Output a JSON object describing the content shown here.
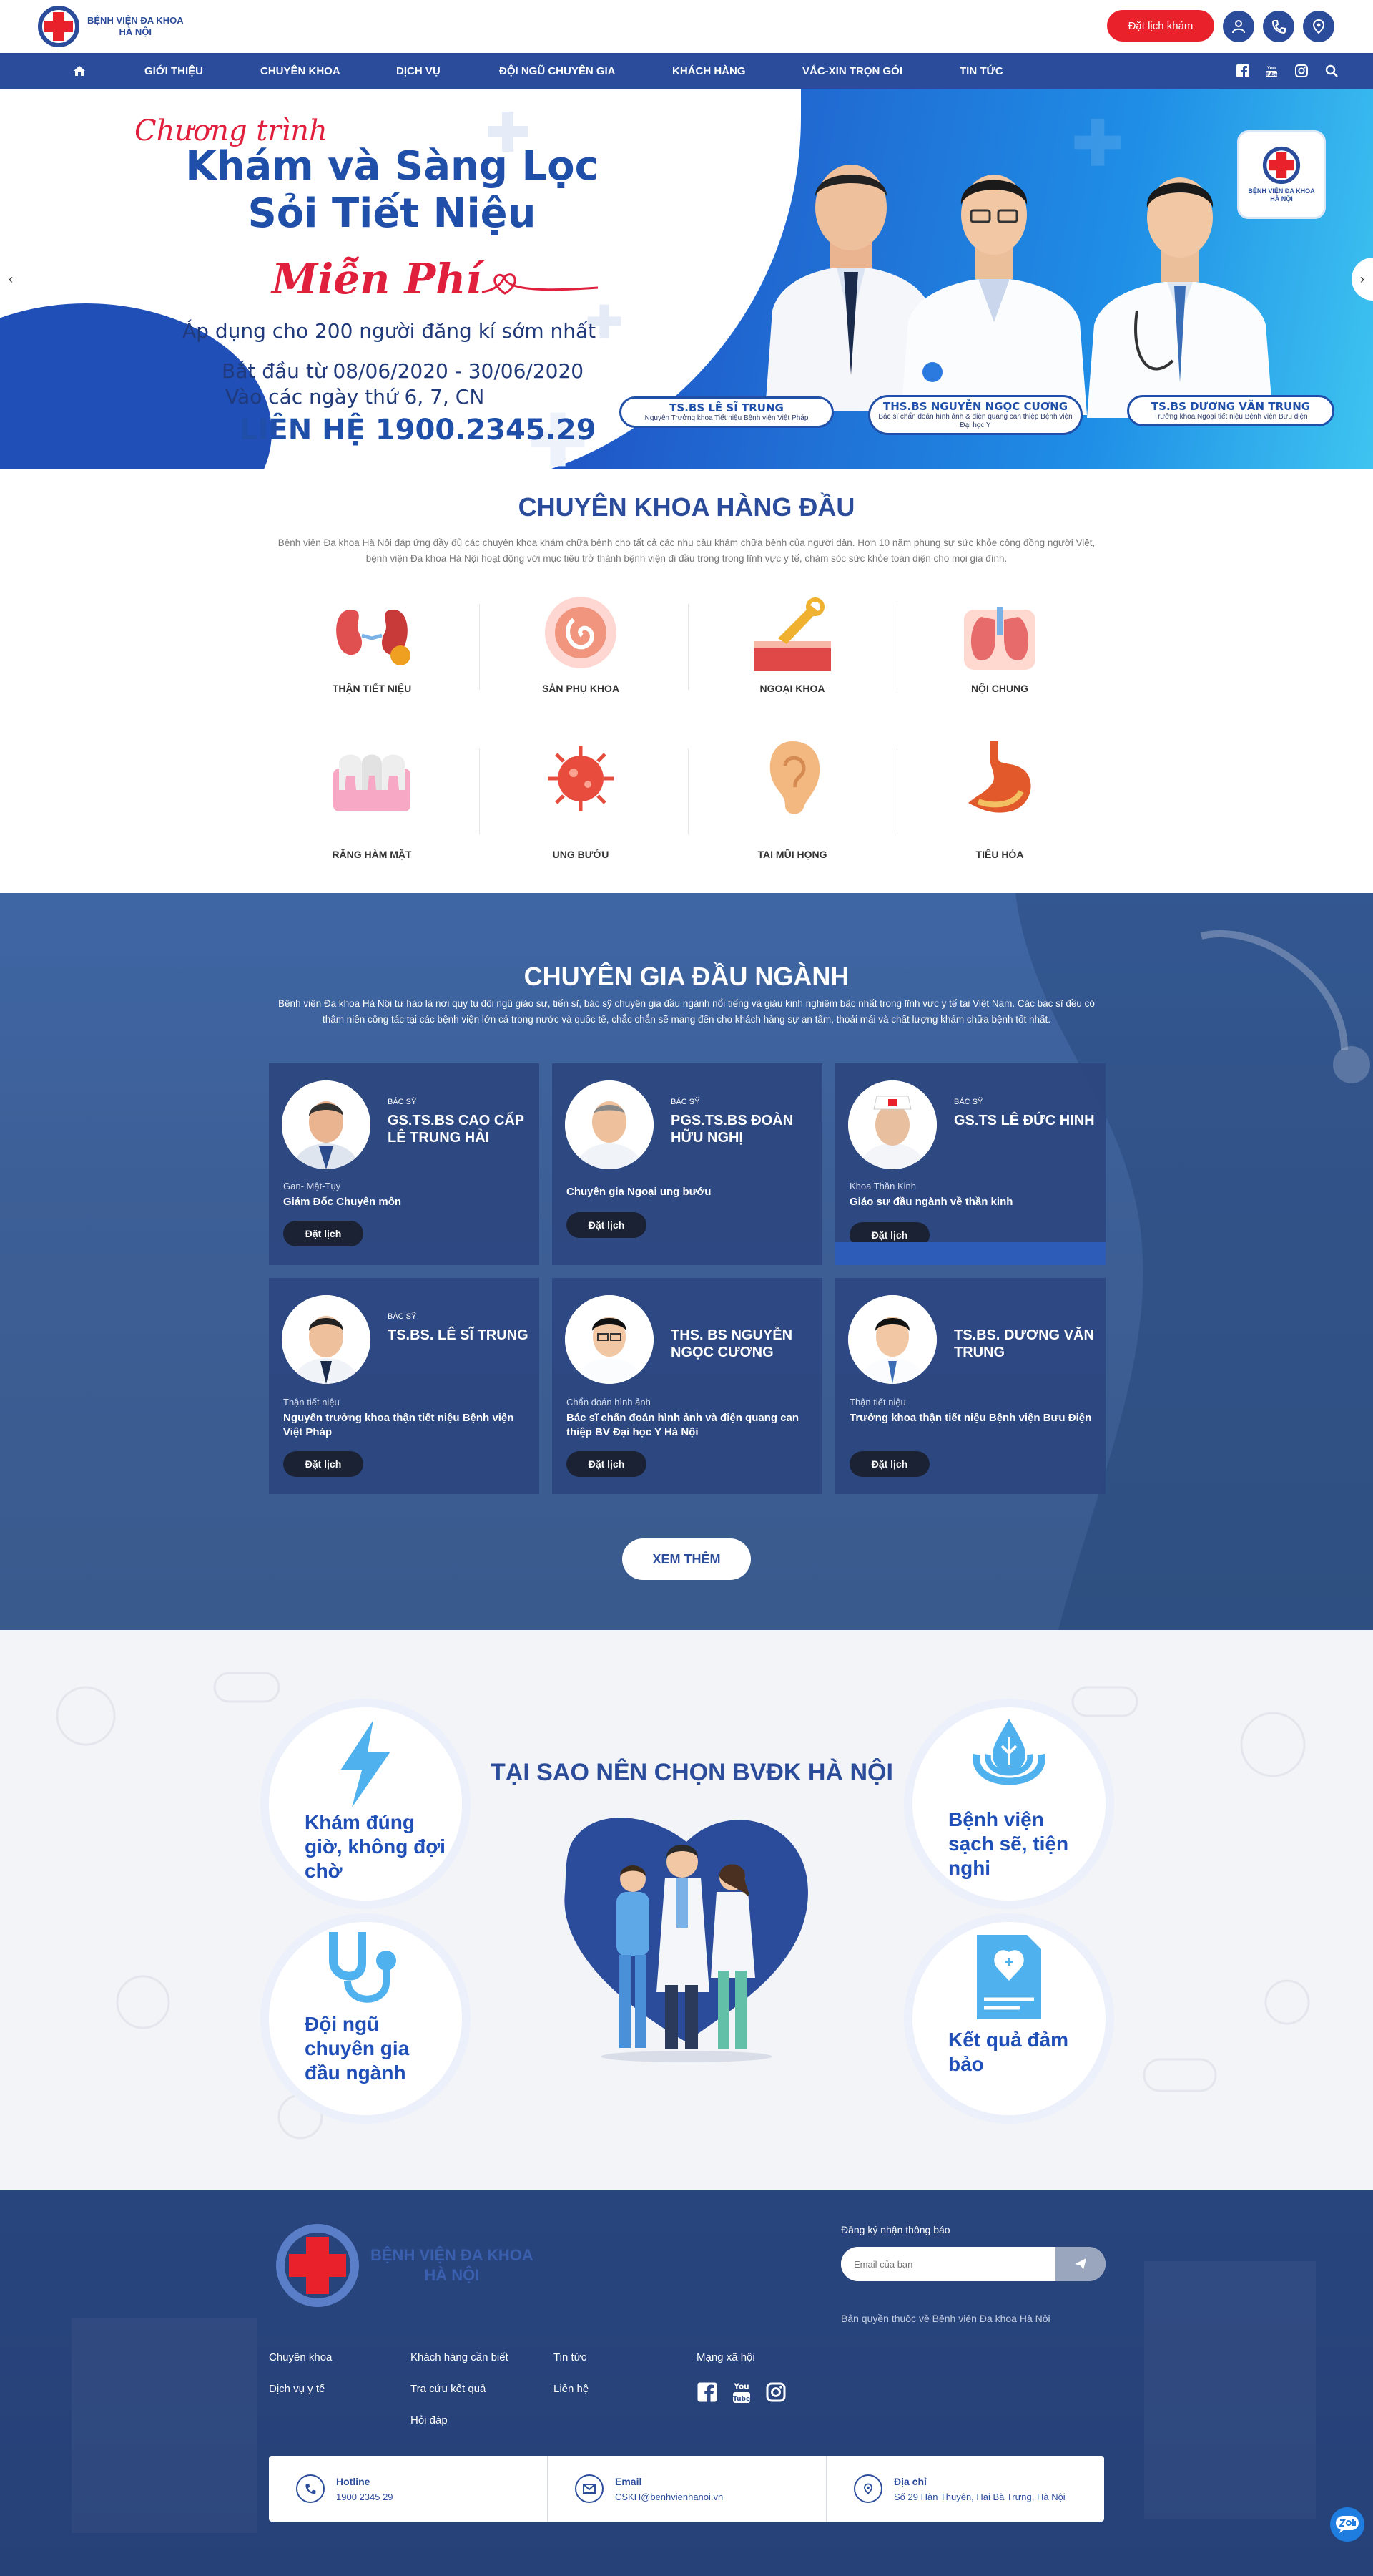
{
  "header": {
    "logo_line1": "BỆNH VIỆN ĐA KHOA",
    "logo_line2": "HÀ NỘI",
    "book_label": "Đặt lịch khám"
  },
  "nav": {
    "items": [
      "GIỚI THIỆU",
      "CHUYÊN KHOA",
      "DỊCH VỤ",
      "ĐỘI NGŨ CHUYÊN GIA",
      "KHÁCH HÀNG",
      "VẮC-XIN TRỌN GÓI",
      "TIN TỨC"
    ]
  },
  "banner": {
    "script": "Chương trình",
    "title_line1": "Khám và Sàng Lọc",
    "title_line2": "Sỏi Tiết Niệu",
    "free": "Miễn Phí",
    "apply": "Áp dụng cho 200 người đăng kí sớm nhất",
    "date": "Bắt đầu từ 08/06/2020 - 30/06/2020",
    "days": "Vào các ngày thứ 6, 7, CN",
    "phone": "LIÊN HỆ 1900.2345.29",
    "doctors": [
      {
        "name": "TS.BS LÊ SĨ TRUNG",
        "desc": "Nguyên Trưởng khoa Tiết niệu Bệnh viện Việt Pháp"
      },
      {
        "name": "THS.BS NGUYỄN NGỌC CƯƠNG",
        "desc": "Bác sĩ chẩn đoán hình ảnh & điện quang can thiệp Bệnh viện Đại học Y"
      },
      {
        "name": "TS.BS DƯƠNG VĂN TRUNG",
        "desc": "Trưởng khoa Ngoại tiết niệu Bệnh viện Bưu điện"
      }
    ]
  },
  "specialties": {
    "title": "CHUYÊN KHOA HÀNG ĐẦU",
    "desc": "Bệnh viện Đa khoa Hà Nội đáp ứng đầy đủ các chuyên khoa khám chữa bệnh cho tất cả các nhu cầu khám chữa bệnh của người dân. Hơn 10 năm phụng sự sức khỏe cộng đồng người Việt, bệnh viện Đa khoa Hà Nội hoạt động với mục tiêu trở thành bệnh viện đi đầu trong trong lĩnh vực y tế, chăm sóc sức khỏe toàn diện cho mọi gia đình.",
    "items": [
      "THẬN TIẾT NIỆU",
      "SẢN PHỤ KHOA",
      "NGOẠI KHOA",
      "NỘI CHUNG",
      "RĂNG HÀM MẶT",
      "UNG BƯỚU",
      "TAI MŨI HỌNG",
      "TIÊU HÓA"
    ]
  },
  "experts": {
    "title": "CHUYÊN GIA ĐẦU NGÀNH",
    "desc": "Bệnh viện Đa khoa Hà Nội tự hào là nơi quy tụ đội ngũ giáo sư, tiến sĩ, bác sỹ chuyên gia đầu ngành nổi tiếng và giàu kinh nghiệm bậc nhất trong lĩnh vực y tế tại Việt Nam. Các bác sĩ đều có thâm niên công tác tại các bệnh viện lớn cả trong nước và quốc tế, chắc chắn sẽ mang đến cho khách hàng sự an tâm, thoải mái và chất lượng khám chữa bệnh tốt nhất.",
    "btn": "Đặt lịch",
    "more": "XEM THÊM",
    "cards": [
      {
        "role": "BÁC SỸ",
        "name": "GS.TS.BS CAO CẤP LÊ TRUNG HẢI",
        "dept": "Gan- Mật-Tụy",
        "pos": "Giám Đốc Chuyên môn"
      },
      {
        "role": "BÁC SỸ",
        "name": "PGS.TS.BS ĐOÀN HỮU NGHỊ",
        "dept": "",
        "pos": "Chuyên gia Ngoại ung bướu"
      },
      {
        "role": "BÁC SỸ",
        "name": "GS.TS LÊ ĐỨC HINH",
        "dept": "Khoa Thần Kinh",
        "pos": "Giáo sư đầu ngành về thần kinh"
      },
      {
        "role": "BÁC SỸ",
        "name": "TS.BS. LÊ SĨ TRUNG",
        "dept": "Thận tiết niệu",
        "pos": "Nguyên trưởng khoa thận tiết niệu Bệnh viện Việt Pháp"
      },
      {
        "role": "",
        "name": "THS. BS NGUYỄN NGỌC CƯƠNG",
        "dept": "Chẩn đoán hình ảnh",
        "pos": "Bác sĩ chẩn đoán hình ảnh và điện quang can thiệp BV Đại học Y Hà Nội"
      },
      {
        "role": "",
        "name": "TS.BS. DƯƠNG VĂN TRUNG",
        "dept": "Thận tiết niệu",
        "pos": "Trưởng khoa thận tiết niệu Bệnh viện Bưu Điện"
      }
    ]
  },
  "why": {
    "title": "TẠI SAO NÊN CHỌN BVĐK HÀ NỘI",
    "items": [
      "Khám đúng giờ, không đợi chờ",
      "Đội ngũ chuyên gia đầu ngành",
      "Bệnh viện sạch sẽ, tiện nghi",
      "Kết quả đảm bảo"
    ]
  },
  "footer": {
    "newsletter_label": "Đăng ký nhận thông báo",
    "email_placeholder": "Email của bạn",
    "copyright": "Bản quyền thuộc về Bệnh viện Đa khoa Hà Nội",
    "links": [
      "Chuyên khoa",
      "Dịch vụ y tế",
      "Khách hàng cần biết",
      "Tra cứu kết quả",
      "Hỏi đáp",
      "Tin tức",
      "Liên hệ",
      "Mạng xã hội"
    ],
    "contacts": [
      {
        "label": "Hotline",
        "value": "1900 2345 29"
      },
      {
        "label": "Email",
        "value": "CSKH@benhvienhanoi.vn"
      },
      {
        "label": "Địa chỉ",
        "value": "Số 29 Hàn Thuyên, Hai Bà Trưng, Hà Nội"
      }
    ]
  },
  "colors": {
    "brand_blue": "#2b4c9b",
    "accent_red": "#e8212b"
  }
}
